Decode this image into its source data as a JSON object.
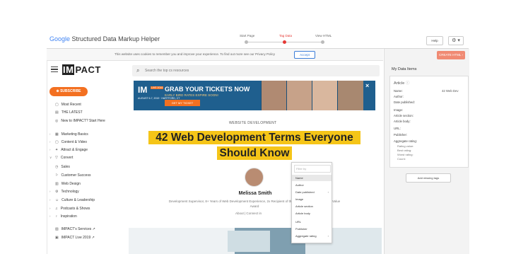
{
  "toolbar": {
    "title_google": "Google",
    "title_rest": "Structured Data Markup Helper",
    "steps": [
      "Start Page",
      "Tag Data",
      "View HTML"
    ],
    "help_label": "Help",
    "gear_icon": "gear-icon"
  },
  "cookie": {
    "text": "This website uses cookies to remember you and improve your experience. To find out more see our Privacy Policy",
    "accept_label": "Accept"
  },
  "right_panel": {
    "create_html_label": "CREATE HTML",
    "title": "My Data Items",
    "article_label": "Article",
    "fields": [
      "Name:",
      "Author:",
      "Date published:",
      "Image:",
      "Article section:",
      "Article body:",
      "URL:",
      "Publisher:",
      "Aggregate rating:"
    ],
    "name_value": "42 Web Dev",
    "subfields": [
      "Rating value:",
      "Best rating:",
      "Worst rating:",
      "Count:"
    ],
    "add_missing_label": "Add missing tags"
  },
  "site": {
    "logo_box": "IM",
    "logo_rest": "PACT",
    "search_placeholder": "Search the top cs resources",
    "subscribe_label": "SUBSCRIBE",
    "nav_top": [
      {
        "icon": "▢",
        "label": "Most Recent"
      },
      {
        "icon": "▤",
        "label": "THE LATEST"
      },
      {
        "icon": "◎",
        "label": "New to IMPACT? Start Here"
      }
    ],
    "nav_main": [
      {
        "arrow": "›",
        "icon": "▦",
        "label": "Marketing Basics"
      },
      {
        "arrow": "›",
        "icon": "▢",
        "label": "Content & Video"
      },
      {
        "arrow": "›",
        "icon": "✦",
        "label": "Attract & Engage"
      },
      {
        "arrow": "∨",
        "icon": "▽",
        "label": "Convert"
      },
      {
        "arrow": "",
        "icon": "◷",
        "label": "Sales"
      },
      {
        "arrow": "",
        "icon": "⚐",
        "label": "Customer Success"
      },
      {
        "arrow": "",
        "icon": "▥",
        "label": "Web Design"
      },
      {
        "arrow": "›",
        "icon": "⚙",
        "label": "Technology"
      },
      {
        "arrow": "›",
        "icon": "☺",
        "label": "Culture & Leadership"
      },
      {
        "arrow": "›",
        "icon": "♫",
        "label": "Podcasts & Shows"
      },
      {
        "arrow": "›",
        "icon": "♀",
        "label": "Inspiration"
      }
    ],
    "nav_bottom": [
      {
        "icon": "▧",
        "label": "IMPACT's Services ↗"
      },
      {
        "icon": "▣",
        "label": "IMPACT Live 2019 ↗"
      }
    ]
  },
  "banner": {
    "logo": "IM",
    "live_badge": "LIVE 2019",
    "date_line": "AUGUST 6-7, 2019 · HARTFORD, CT",
    "headline": "GRAB YOUR TICKETS NOW",
    "subline": "EARLY BIRD RATES EXPIRE SOON!",
    "cta": "GET MY TICKET",
    "close": "×"
  },
  "article": {
    "kicker": "WEBSITE DEVELOPMENT",
    "title_line1": "42 Web Development Terms Everyone",
    "title_line2": "Should Know",
    "author": "Melissa Smith",
    "bio1": "Development Supervisor, 8+ Years of Web Development Experience, 2x Recipient of the IMPACT Web Partner Of It Value",
    "bio2": "Award",
    "links": "About  |  Connect  in"
  },
  "dropdown": {
    "filter_placeholder": "Filter by",
    "items": [
      "Name",
      "Author",
      "Date published",
      "Image",
      "Article section",
      "Article body",
      "URL",
      "Publisher",
      "Aggregate rating"
    ],
    "active_index": 0,
    "submenu_items": [
      "Date published",
      "Aggregate rating"
    ]
  }
}
